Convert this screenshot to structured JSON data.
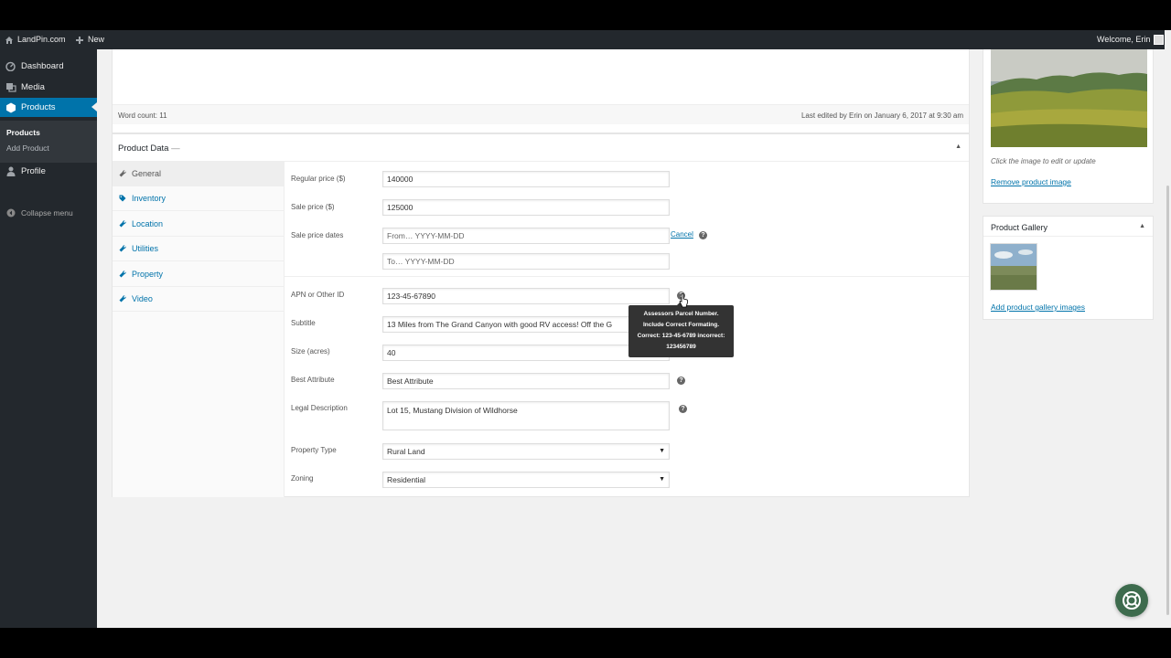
{
  "admin_bar": {
    "site_name": "LandPin.com",
    "new_label": "New",
    "welcome": "Welcome, Erin"
  },
  "sidebar": {
    "items": [
      {
        "label": "Dashboard",
        "icon": "dashboard-icon"
      },
      {
        "label": "Media",
        "icon": "media-icon"
      },
      {
        "label": "Products",
        "icon": "products-icon",
        "active": true
      },
      {
        "label": "Profile",
        "icon": "profile-icon"
      }
    ],
    "submenu": [
      "Products",
      "Add Product"
    ],
    "collapse_label": "Collapse menu"
  },
  "editor": {
    "word_count": "Word count: 11",
    "last_edited": "Last edited by Erin on January 6, 2017 at 9:30 am"
  },
  "product_data": {
    "title": "Product Data",
    "title_suffix": "—",
    "tabs": [
      {
        "label": "General",
        "icon": "wrench-icon",
        "active": true
      },
      {
        "label": "Inventory",
        "icon": "tag-icon"
      },
      {
        "label": "Location",
        "icon": "wrench-icon"
      },
      {
        "label": "Utilities",
        "icon": "wrench-icon"
      },
      {
        "label": "Property",
        "icon": "wrench-icon"
      },
      {
        "label": "Video",
        "icon": "wrench-icon"
      }
    ],
    "fields": {
      "regular_price": {
        "label": "Regular price ($)",
        "value": "140000"
      },
      "sale_price": {
        "label": "Sale price ($)",
        "value": "125000"
      },
      "sale_dates": {
        "label": "Sale price dates",
        "from_placeholder": "From… YYYY-MM-DD",
        "to_placeholder": "To…  YYYY-MM-DD",
        "cancel": "Cancel"
      },
      "apn": {
        "label": "APN or Other ID",
        "value": "123-45-67890"
      },
      "subtitle": {
        "label": "Subtitle",
        "value": "13 Miles from The Grand Canyon with good RV access! Off the G"
      },
      "size": {
        "label": "Size (acres)",
        "value": "40"
      },
      "best_attribute": {
        "label": "Best Attribute",
        "value": "Best Attribute"
      },
      "legal_description": {
        "label": "Legal Description",
        "value": "Lot 15, Mustang Division of Wildhorse"
      },
      "property_type": {
        "label": "Property Type",
        "value": "Rural Land"
      },
      "zoning": {
        "label": "Zoning",
        "value": "Residential"
      }
    },
    "tooltip": [
      "Assessors Parcel Number.",
      "Include Correct Formating.",
      "Correct: 123-45-6789 incorrect:",
      "123456789"
    ]
  },
  "featured_image": {
    "caption": "Click the image to edit or update",
    "remove_link": "Remove product image"
  },
  "gallery": {
    "title": "Product Gallery",
    "add_link": "Add product gallery images"
  },
  "colors": {
    "admin_dark": "#23282d",
    "accent_blue": "#0073aa",
    "help_green": "#3d6b4d"
  }
}
